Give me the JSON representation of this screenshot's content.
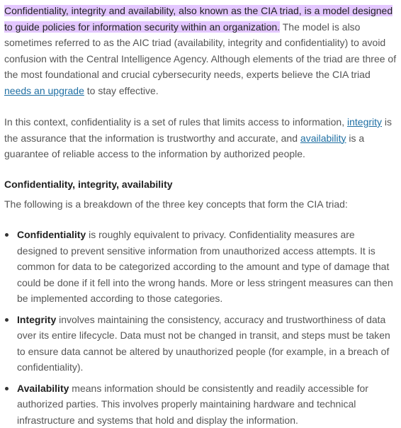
{
  "paragraph1": {
    "highlighted": "Confidentiality, integrity and availability, also known as the CIA triad, is a model designed to guide policies for information security within an organization.",
    "text_before_link": " The model is also sometimes referred to as the AIC triad (availability, integrity and confidentiality) to avoid confusion with the Central Intelligence Agency. Although elements of the triad are three of the most foundational and crucial cybersecurity needs, experts believe the CIA triad ",
    "link": "needs an upgrade",
    "text_after_link": " to stay effective."
  },
  "paragraph2": {
    "text1": "In this context, confidentiality is a set of rules that limits access to information, ",
    "link1": "integrity",
    "text2": " is the assurance that the information is trustworthy and accurate, and ",
    "link2": "availability",
    "text3": " is a guarantee of reliable access to the information by authorized people."
  },
  "heading": "Confidentiality, integrity, availability",
  "intro": "The following is a breakdown of the three key concepts that form the CIA triad:",
  "concepts": [
    {
      "term": "Confidentiality",
      "text": " is roughly equivalent to privacy. Confidentiality measures are designed to prevent sensitive information from unauthorized access attempts. It is common for data to be categorized according to the amount and type of damage that could be done if it fell into the wrong hands. More or less stringent measures can then be implemented according to those categories."
    },
    {
      "term": "Integrity",
      "text": " involves maintaining the consistency, accuracy and trustworthiness of data over its entire lifecycle. Data must not be changed in transit, and steps must be taken to ensure data cannot be altered by unauthorized people (for example, in a breach of confidentiality)."
    },
    {
      "term": "Availability",
      "text": " means information should be consistently and readily accessible for authorized parties. This involves properly maintaining hardware and technical infrastructure and systems that hold and display the information."
    }
  ],
  "colors": {
    "highlight": "#e3c7ff",
    "link": "#1f6fa3",
    "body_text": "#555555",
    "strong_text": "#222222"
  }
}
